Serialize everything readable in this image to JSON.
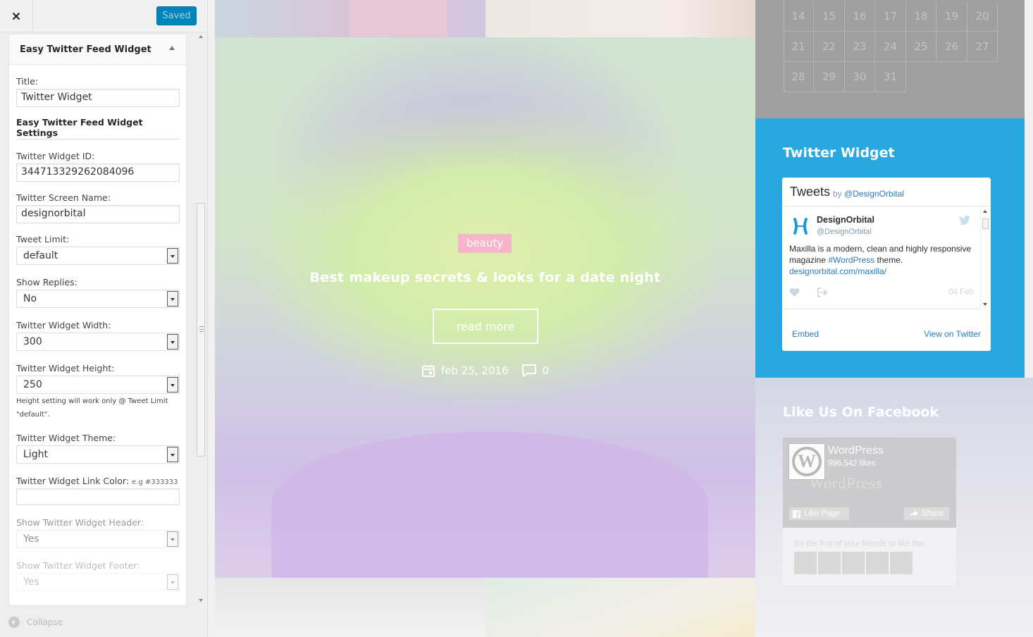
{
  "customizer": {
    "save_label": "Saved",
    "widget_title": "Easy Twitter Feed Widget",
    "collapse_label": "Collapse",
    "fields": {
      "title_label": "Title:",
      "title_value": "Twitter Widget",
      "settings_heading": "Easy Twitter Feed Widget Settings",
      "widget_id_label": "Twitter Widget ID:",
      "widget_id_value": "344713329262084096",
      "screen_name_label": "Twitter Screen Name:",
      "screen_name_value": "designorbital",
      "tweet_limit_label": "Tweet Limit:",
      "tweet_limit_value": "default",
      "show_replies_label": "Show Replies:",
      "show_replies_value": "No",
      "width_label": "Twitter Widget Width:",
      "width_value": "300",
      "height_label": "Twitter Widget Height:",
      "height_value": "250",
      "height_help_1": "Height setting will work only @ Tweet Limit",
      "height_help_2": "\"default\".",
      "theme_label": "Twitter Widget Theme:",
      "theme_value": "Light",
      "link_color_label": "Twitter Widget Link Color:",
      "link_color_hint": "e.g #333333",
      "link_color_value": "",
      "show_header_label": "Show Twitter Widget Header:",
      "show_header_value": "Yes",
      "show_footer_label": "Show Twitter Widget Footer:",
      "show_footer_value": "Yes"
    }
  },
  "preview": {
    "hero": {
      "tag": "beauty",
      "title": "Best makeup secrets & looks for a date night",
      "read_more": "read more",
      "date": "feb 25, 2016",
      "comments": "0"
    },
    "calendar": {
      "rows": [
        [
          "14",
          "15",
          "16",
          "17",
          "18",
          "19",
          "20"
        ],
        [
          "21",
          "22",
          "23",
          "24",
          "25",
          "26",
          "27"
        ],
        [
          "28",
          "29",
          "30",
          "31"
        ]
      ]
    },
    "twitter_widget": {
      "title": "Twitter Widget",
      "tweets_label": "Tweets",
      "by_label": "by",
      "by_handle": "@DesignOrbital",
      "author_name": "DesignOrbital",
      "author_handle": "@DesignOrbital",
      "text_1": "Maxilla is a modern, clean and highly responsive magazine ",
      "hashtag": "#WordPress",
      "text_2": " theme.",
      "link": "designorbital.com/maxilla/",
      "date": "04 Feb",
      "embed_label": "Embed",
      "view_label": "View on Twitter"
    },
    "facebook_widget": {
      "title": "Like Us On Facebook",
      "page_name": "WordPress",
      "likes": "996,542 likes",
      "wordmark": "WordPress",
      "like_button": "Like Page",
      "share_button": "Share",
      "friends_text": "Be the first of your friends to like this"
    }
  },
  "colors": {
    "twitter_blue": "#29a8df",
    "wp_primary": "#0085ba",
    "beauty_tag": "#f5b5ca"
  }
}
